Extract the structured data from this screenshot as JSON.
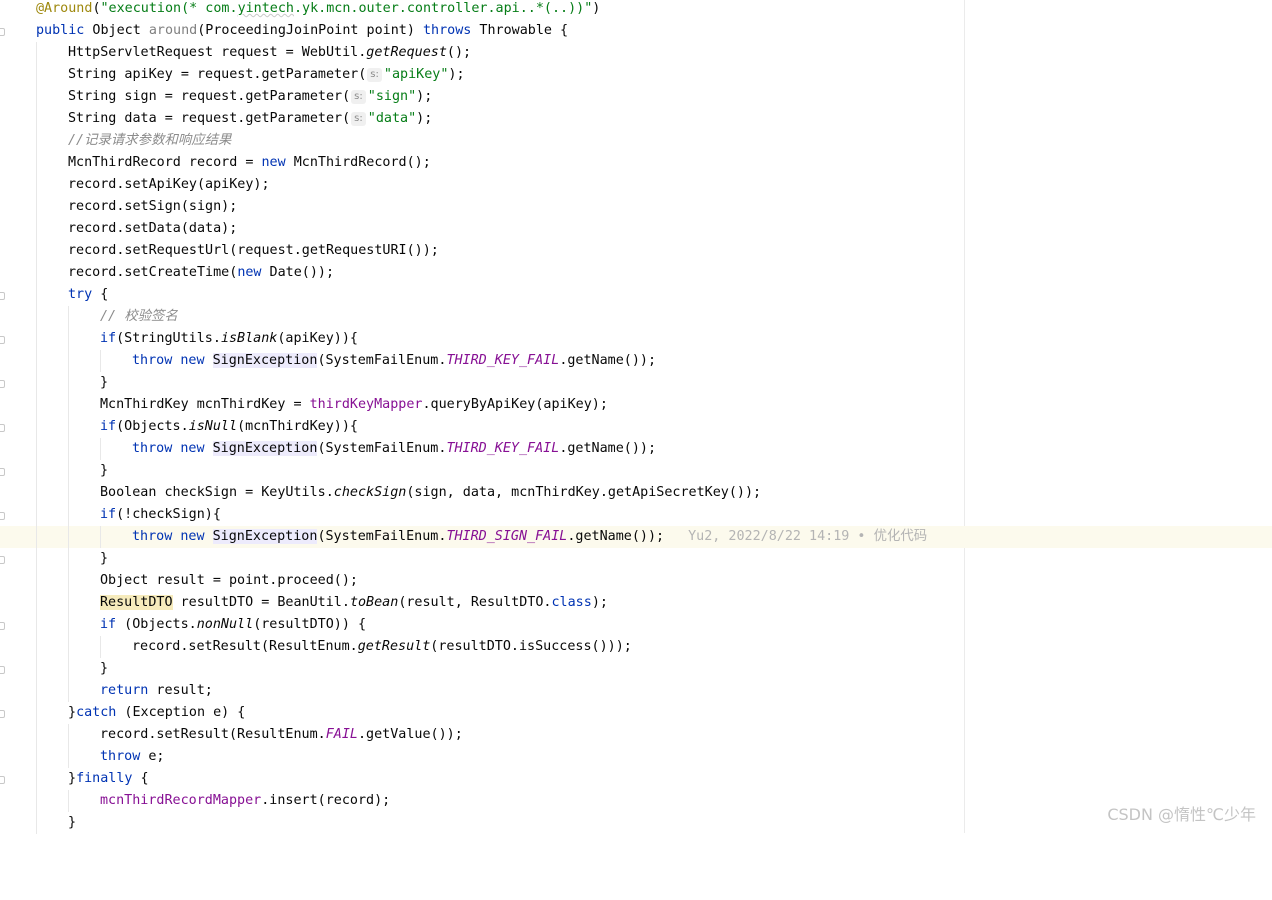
{
  "editor": {
    "annotation_line": {
      "at": "@Around",
      "paren_open": "(",
      "str_a": "\"execution(* com.",
      "str_b": "yintech",
      "str_c": ".yk.mcn.outer.controller.api..*(..))\"",
      "paren_close": ")"
    },
    "l2": {
      "kw1": "public",
      "t1": " Object ",
      "name": "around",
      "t2": "(ProceedingJoinPoint point) ",
      "kw2": "throws",
      "t3": " Throwable {"
    },
    "l3": {
      "t1": "HttpServletRequest request = WebUtil.",
      "call": "getRequest",
      "t2": "();"
    },
    "l4": {
      "t1": "String apiKey = request.getParameter(",
      "hint": "s:",
      "str": "\"apiKey\"",
      "t2": ");"
    },
    "l5": {
      "t1": "String sign = request.getParameter(",
      "hint": "s:",
      "str": "\"sign\"",
      "t2": ");"
    },
    "l6": {
      "t1": "String data = request.getParameter(",
      "hint": "s:",
      "str": "\"data\"",
      "t2": ");"
    },
    "l7": {
      "slashes": "//",
      "text": "记录请求参数和响应结果"
    },
    "l8": {
      "t1": "McnThirdRecord record = ",
      "kw": "new",
      "t2": " McnThirdRecord();"
    },
    "l9": {
      "t1": "record.setApiKey(apiKey);"
    },
    "l10": {
      "t1": "record.setSign(sign);"
    },
    "l11": {
      "t1": "record.setData(data);"
    },
    "l12": {
      "t1": "record.setRequestUrl(request.getRequestURI());"
    },
    "l13": {
      "t1": "record.setCreateTime(",
      "kw": "new",
      "t2": " Date());"
    },
    "l14": {
      "kw": "try",
      "t1": " {"
    },
    "l15": {
      "slashes": "// ",
      "text": "校验签名"
    },
    "l16": {
      "kw": "if",
      "t1": "(StringUtils.",
      "call": "isBlank",
      "t2": "(apiKey)){"
    },
    "l17": {
      "kw1": "throw",
      "kw2": "new",
      "cls": "SignException",
      "t1": "(SystemFailEnum.",
      "const": "THIRD_KEY_FAIL",
      "t2": ".getName());"
    },
    "l18": {
      "t1": "}"
    },
    "l19": {
      "t1": "McnThirdKey mcnThirdKey = ",
      "field": "thirdKeyMapper",
      "t2": ".queryByApiKey(apiKey);"
    },
    "l20": {
      "kw": "if",
      "t1": "(Objects.",
      "call": "isNull",
      "t2": "(mcnThirdKey)){"
    },
    "l21": {
      "kw1": "throw",
      "kw2": "new",
      "cls": "SignException",
      "t1": "(SystemFailEnum.",
      "const": "THIRD_KEY_FAIL",
      "t2": ".getName());"
    },
    "l22": {
      "t1": "}"
    },
    "l23": {
      "t1": "Boolean checkSign = KeyUtils.",
      "call": "checkSign",
      "t2": "(sign, data, mcnThirdKey.getApiSecretKey());"
    },
    "l24": {
      "kw": "if",
      "t1": "(!checkSign){"
    },
    "l25": {
      "kw1": "throw",
      "kw2": "new",
      "cls": "SignException",
      "t1": "(SystemFailEnum.",
      "const": "THIRD_SIGN_FAIL",
      "t2": ".getName());",
      "blame_author": "Yu2, 2022/8/22 14:19 • ",
      "blame_msg": "优化代码"
    },
    "l26": {
      "t1": "}"
    },
    "l27": {
      "t1": "Object result = point.proceed();"
    },
    "l28": {
      "cls": "ResultDTO",
      "t1": " resultDTO = BeanUtil.",
      "call": "toBean",
      "t2": "(result, ResultDTO.",
      "kw": "class",
      "t3": ");"
    },
    "l29": {
      "kw": "if",
      "t1": " (Objects.",
      "call": "nonNull",
      "t2": "(resultDTO)) {"
    },
    "l30": {
      "t1": "record.setResult(ResultEnum.",
      "call": "getResult",
      "t2": "(resultDTO.isSuccess()));"
    },
    "l31": {
      "t1": "}"
    },
    "l32": {
      "kw": "return",
      "t1": " result;"
    },
    "l33": {
      "t1": "}",
      "kw": "catch",
      "t2": " (Exception e) {"
    },
    "l34": {
      "t1": "record.setResult(ResultEnum.",
      "const": "FAIL",
      "t2": ".getValue());"
    },
    "l35": {
      "kw": "throw",
      "t1": " e;"
    },
    "l36": {
      "t1": "}",
      "kw": "finally",
      "t2": " {"
    },
    "l37": {
      "field": "mcnThirdRecordMapper",
      "t1": ".insert(record);"
    },
    "l38": {
      "t1": "}"
    }
  },
  "watermark": "CSDN @惰性℃少年",
  "colors": {
    "keyword": "#0033b3",
    "string": "#067d17",
    "annotation": "#9e880d",
    "constant": "#871094",
    "comment": "#8c8c8c",
    "current_line": "#fcfaed"
  }
}
